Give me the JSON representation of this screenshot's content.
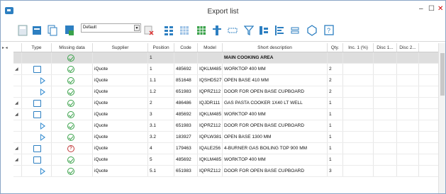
{
  "window": {
    "title": "Export list",
    "min": "–",
    "max": "☐",
    "close": "✕"
  },
  "toolbar": {
    "preset": "Default"
  },
  "columns": [
    "Type",
    "Missing data",
    "Supplier",
    "Position",
    "Code",
    "Model",
    "Short description",
    "Qty.",
    "Inc. 1 (%)",
    "Disc 1...",
    "Disc 2..."
  ],
  "rows": [
    {
      "kind": "group",
      "status": "ok",
      "supplier": "",
      "position": "1",
      "code": "",
      "model": "",
      "desc": "MAIN COOKING AREA",
      "qty": ""
    },
    {
      "kind": "page",
      "status": "ok",
      "supplier": "iQuote",
      "position": "1",
      "code": "485692",
      "model": "IQKLM485",
      "desc": "WORKTOP 400 MM",
      "qty": "2"
    },
    {
      "kind": "tri",
      "status": "ok",
      "supplier": "iQuote",
      "position": "1.1",
      "code": "851648",
      "model": "IQSHD527",
      "desc": "OPEN BASE 410 MM",
      "qty": "2"
    },
    {
      "kind": "tri",
      "status": "ok",
      "supplier": "iQuote",
      "position": "1.2",
      "code": "651983",
      "model": "IQPRZ112",
      "desc": "DOOR FOR OPEN BASE CUPBOARD",
      "qty": "2"
    },
    {
      "kind": "page",
      "status": "ok",
      "supplier": "iQuote",
      "position": "2",
      "code": "486486",
      "model": "IQJDR111",
      "desc": "GAS PASTA COOKER 1X40 LT WELL",
      "qty": "1"
    },
    {
      "kind": "page",
      "status": "ok",
      "supplier": "iQuote",
      "position": "3",
      "code": "485692",
      "model": "IQKLM485",
      "desc": "WORKTOP 400 MM",
      "qty": "1"
    },
    {
      "kind": "tri",
      "status": "ok",
      "supplier": "iQuote",
      "position": "3.1",
      "code": "651983",
      "model": "IQPRZ112",
      "desc": "DOOR FOR OPEN BASE CUPBOARD",
      "qty": "1"
    },
    {
      "kind": "tri",
      "status": "ok",
      "supplier": "iQuote",
      "position": "3.2",
      "code": "183927",
      "model": "IQPLW381",
      "desc": "OPEN BASE 1300 MM",
      "qty": "1"
    },
    {
      "kind": "page",
      "status": "warn",
      "supplier": "iQuote",
      "position": "4",
      "code": "179463",
      "model": "IQALE256",
      "desc": "4-BURNER GAS BOILING TOP 900 MM",
      "qty": "1"
    },
    {
      "kind": "page",
      "status": "ok",
      "supplier": "iQuote",
      "position": "5",
      "code": "485692",
      "model": "IQKLM485",
      "desc": "WORKTOP 400 MM",
      "qty": "1"
    },
    {
      "kind": "tri",
      "status": "ok",
      "supplier": "iQuote",
      "position": "5.1",
      "code": "651983",
      "model": "IQPRZ112",
      "desc": "DOOR FOR OPEN BASE CUPBOARD",
      "qty": "3"
    }
  ]
}
